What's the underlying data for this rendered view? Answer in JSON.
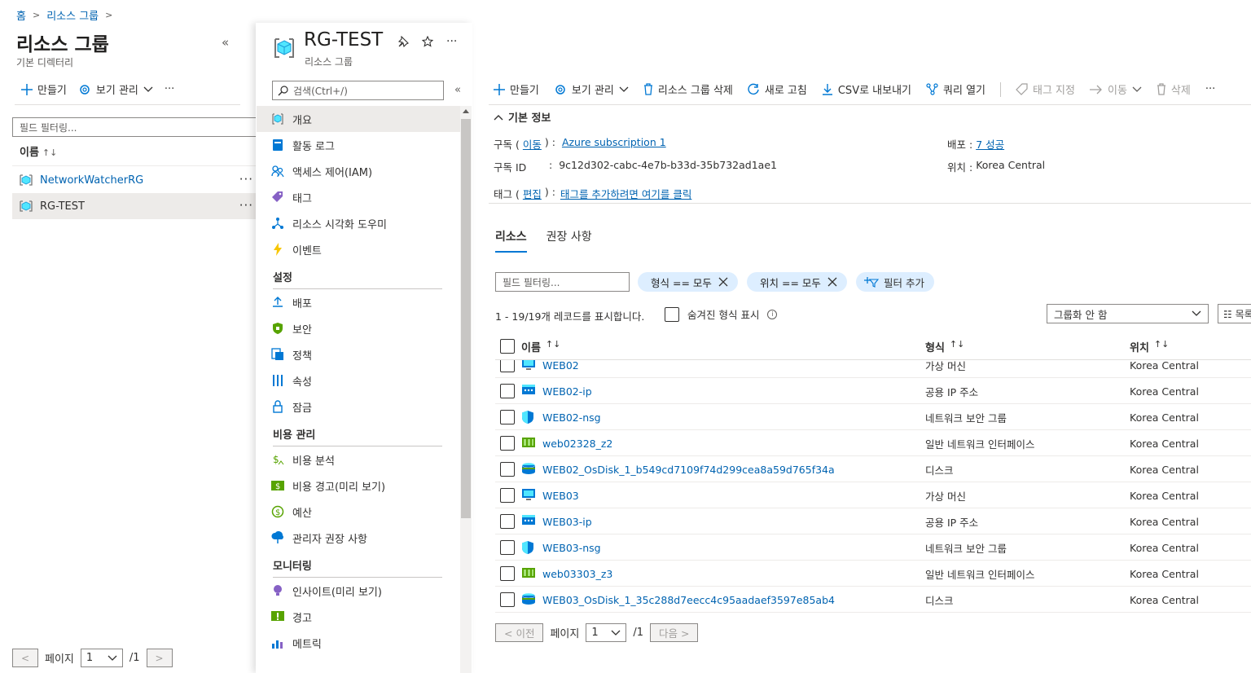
{
  "breadcrumb": {
    "home": "홈",
    "group": "리소스 그룹"
  },
  "left_panel": {
    "title": "리소스 그룹",
    "subtitle": "기본 디렉터리",
    "collapse": "«",
    "create": "만들기",
    "view_manage": "보기 관리",
    "more": "···",
    "filter_placeholder": "필드 필터링...",
    "col_name": "이름",
    "sort": "↑↓",
    "items": [
      {
        "name": "NetworkWatcherRG"
      },
      {
        "name": "RG-TEST"
      }
    ],
    "pager": {
      "prev": "<",
      "label": "페이지",
      "value": "1",
      "total": "/1",
      "next": ">"
    }
  },
  "menu_panel": {
    "title": "RG-TEST",
    "subtitle": "리소스 그룹",
    "search_placeholder": "검색(Ctrl+/)",
    "collapse": "«",
    "items_top": [
      {
        "label": "개요",
        "icon": "cube-icon"
      },
      {
        "label": "활동 로그",
        "icon": "log-icon"
      },
      {
        "label": "액세스 제어(IAM)",
        "icon": "people-icon"
      },
      {
        "label": "태그",
        "icon": "tag-icon"
      },
      {
        "label": "리소스 시각화 도우미",
        "icon": "graph-icon"
      },
      {
        "label": "이벤트",
        "icon": "bolt-icon"
      }
    ],
    "sec_settings": "설정",
    "items_settings": [
      {
        "label": "배포",
        "icon": "upload-icon"
      },
      {
        "label": "보안",
        "icon": "shield-icon"
      },
      {
        "label": "정책",
        "icon": "policy-icon"
      },
      {
        "label": "속성",
        "icon": "bars-icon"
      },
      {
        "label": "잠금",
        "icon": "lock-icon"
      }
    ],
    "sec_cost": "비용 관리",
    "items_cost": [
      {
        "label": "비용 분석",
        "icon": "cost-analysis-icon"
      },
      {
        "label": "비용 경고(미리 보기)",
        "icon": "cost-alert-icon"
      },
      {
        "label": "예산",
        "icon": "budget-icon"
      },
      {
        "label": "관리자 권장 사항",
        "icon": "advisor-icon"
      }
    ],
    "sec_monitor": "모니터링",
    "items_monitor": [
      {
        "label": "인사이트(미리 보기)",
        "icon": "bulb-icon"
      },
      {
        "label": "경고",
        "icon": "alert-icon"
      },
      {
        "label": "메트릭",
        "icon": "metrics-icon"
      }
    ]
  },
  "main": {
    "toolbar": {
      "create": "만들기",
      "view_manage": "보기 관리",
      "delete_group": "리소스 그룹 삭제",
      "refresh": "새로 고침",
      "export_csv": "CSV로 내보내기",
      "open_query": "쿼리 열기",
      "assign_tags": "태그 지정",
      "move": "이동",
      "delete": "삭제",
      "more": "···"
    },
    "essentials": {
      "toggle": "기본 정보",
      "subscription_label": "구독 (",
      "subscription_move": "이동",
      "subscription_sep": ") :",
      "subscription_value": "Azure subscription 1",
      "subscription_id_label": "구독 ID",
      "subscription_id_sep": ":",
      "subscription_id_value": "9c12d302-cabc-4e7b-b33d-35b732ad1ae1",
      "tags_label": "태그 (",
      "tags_edit": "편집",
      "tags_sep": ") :",
      "tags_value": "태그를 추가하려면 여기를 클릭",
      "deploy_label": "배포 :",
      "deploy_value": "7 성공",
      "location_label": "위치 :",
      "location_value": "Korea Central"
    },
    "tabs": [
      "리소스",
      "권장 사항"
    ],
    "filter_placeholder": "필드 필터링...",
    "pills": {
      "type": "형식 == 모두",
      "location": "위치 == 모두",
      "add": "필터 추가"
    },
    "records": "1 - 19/19개 레코드를 표시합니다.",
    "show_hidden": "숨겨진 형식 표시",
    "grouping": "그룹화 안 함",
    "list_view": "☷ 목록 보기",
    "columns": {
      "name": "이름",
      "type": "형식",
      "location": "위치",
      "sort": "↑↓"
    },
    "rows": [
      {
        "name": "WEB02",
        "type": "가상 머신",
        "location": "Korea Central",
        "icon": "vm-icon"
      },
      {
        "name": "WEB02-ip",
        "type": "공용 IP 주소",
        "location": "Korea Central",
        "icon": "public-ip-icon"
      },
      {
        "name": "WEB02-nsg",
        "type": "네트워크 보안 그룹",
        "location": "Korea Central",
        "icon": "nsg-icon"
      },
      {
        "name": "web02328_z2",
        "type": "일반 네트워크 인터페이스",
        "location": "Korea Central",
        "icon": "nic-icon"
      },
      {
        "name": "WEB02_OsDisk_1_b549cd7109f74d299cea8a59d765f34a",
        "type": "디스크",
        "location": "Korea Central",
        "icon": "disk-icon"
      },
      {
        "name": "WEB03",
        "type": "가상 머신",
        "location": "Korea Central",
        "icon": "vm-icon"
      },
      {
        "name": "WEB03-ip",
        "type": "공용 IP 주소",
        "location": "Korea Central",
        "icon": "public-ip-icon"
      },
      {
        "name": "WEB03-nsg",
        "type": "네트워크 보안 그룹",
        "location": "Korea Central",
        "icon": "nsg-icon"
      },
      {
        "name": "web03303_z3",
        "type": "일반 네트워크 인터페이스",
        "location": "Korea Central",
        "icon": "nic-icon"
      },
      {
        "name": "WEB03_OsDisk_1_35c288d7eecc4c95aadaef3597e85ab4",
        "type": "디스크",
        "location": "Korea Central",
        "icon": "disk-icon"
      }
    ],
    "pager": {
      "prev": "< 이전",
      "label": "페이지",
      "value": "1",
      "total": "/1",
      "next": "다음 >"
    }
  },
  "colors": {
    "accent": "#0078d4",
    "link": "#0063b1",
    "pill": "#ddeeff"
  }
}
